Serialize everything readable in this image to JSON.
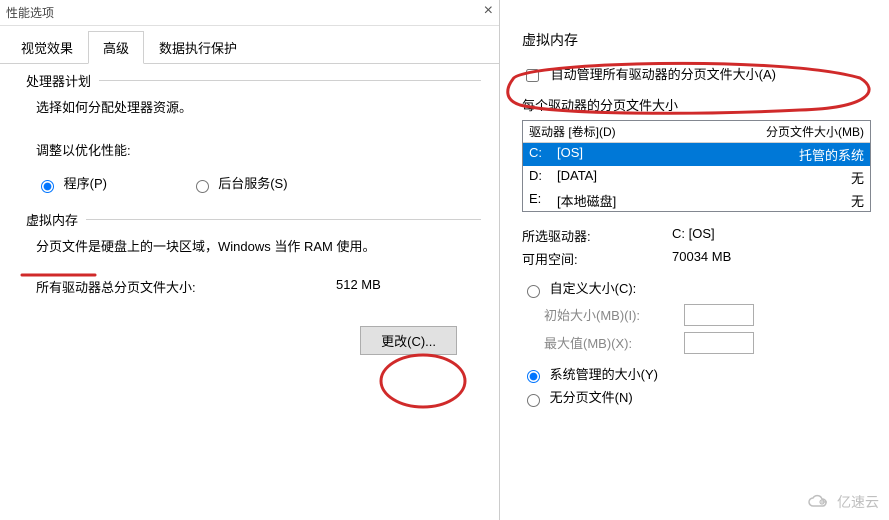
{
  "left": {
    "window_title": "性能选项",
    "tabs": {
      "visual": "视觉效果",
      "advanced": "高级",
      "dep": "数据执行保护"
    },
    "cpu": {
      "title": "处理器计划",
      "desc": "选择如何分配处理器资源。",
      "adjust_label": "调整以优化性能:",
      "opt_programs": "程序(P)",
      "opt_services": "后台服务(S)"
    },
    "vm": {
      "title": "虚拟内存",
      "desc": "分页文件是硬盘上的一块区域，Windows 当作 RAM 使用。",
      "total_label": "所有驱动器总分页文件大小:",
      "total_value": "512 MB",
      "change_btn": "更改(C)..."
    }
  },
  "right": {
    "title": "虚拟内存",
    "auto_checkbox": "自动管理所有驱动器的分页文件大小(A)",
    "per_drive_label": "每个驱动器的分页文件大小",
    "col_drive": "驱动器 [卷标](D)",
    "col_size": "分页文件大小(MB)",
    "drives": [
      {
        "letter": "C:",
        "label": "[OS]",
        "size": "托管的系统",
        "selected": true
      },
      {
        "letter": "D:",
        "label": "[DATA]",
        "size": "无",
        "selected": false
      },
      {
        "letter": "E:",
        "label": "[本地磁盘]",
        "size": "无",
        "selected": false
      }
    ],
    "selected_drive_k": "所选驱动器:",
    "selected_drive_v": "C:  [OS]",
    "free_space_k": "可用空间:",
    "free_space_v": "70034 MB",
    "opt_custom": "自定义大小(C):",
    "initial_label": "初始大小(MB)(I):",
    "max_label": "最大值(MB)(X):",
    "opt_system": "系统管理的大小(Y)",
    "opt_none": "无分页文件(N)"
  },
  "watermark": "亿速云"
}
